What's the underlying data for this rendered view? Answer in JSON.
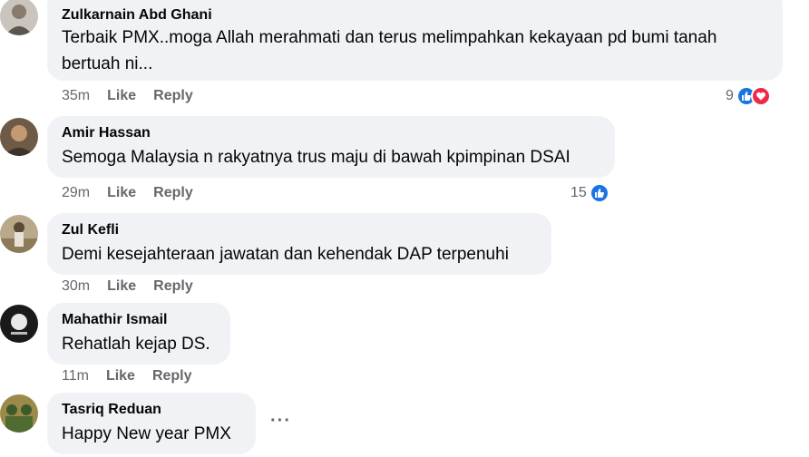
{
  "comments": [
    {
      "author": "Zulkarnain Abd Ghani",
      "text_line1": "Terbaik PMX..moga Allah merahmati dan terus melimpahkan kekayaan pd bumi tanah",
      "text_line2": "bertuah ni...",
      "time": "35m",
      "like_label": "Like",
      "reply_label": "Reply",
      "reaction_count": "9",
      "reactions": [
        "like-icon",
        "love-icon"
      ]
    },
    {
      "author": "Amir Hassan",
      "text": "Semoga Malaysia n rakyatnya trus maju di bawah kpimpinan DSAI",
      "time": "29m",
      "like_label": "Like",
      "reply_label": "Reply",
      "reaction_count": "15",
      "reactions": [
        "like-icon"
      ]
    },
    {
      "author": "Zul Kefli",
      "text": "Demi kesejahteraan jawatan dan kehendak DAP terpenuhi",
      "time": "30m",
      "like_label": "Like",
      "reply_label": "Reply"
    },
    {
      "author": "Mahathir Ismail",
      "text": "Rehatlah kejap DS.",
      "time": "11m",
      "like_label": "Like",
      "reply_label": "Reply"
    },
    {
      "author": "Tasriq Reduan",
      "text": "Happy New year PMX",
      "more_label": "···"
    }
  ],
  "colors": {
    "bubble": "#f0f2f5",
    "meta_text": "#65676b",
    "like_blue": "#1b74e4",
    "love_red": "#f0284a"
  }
}
